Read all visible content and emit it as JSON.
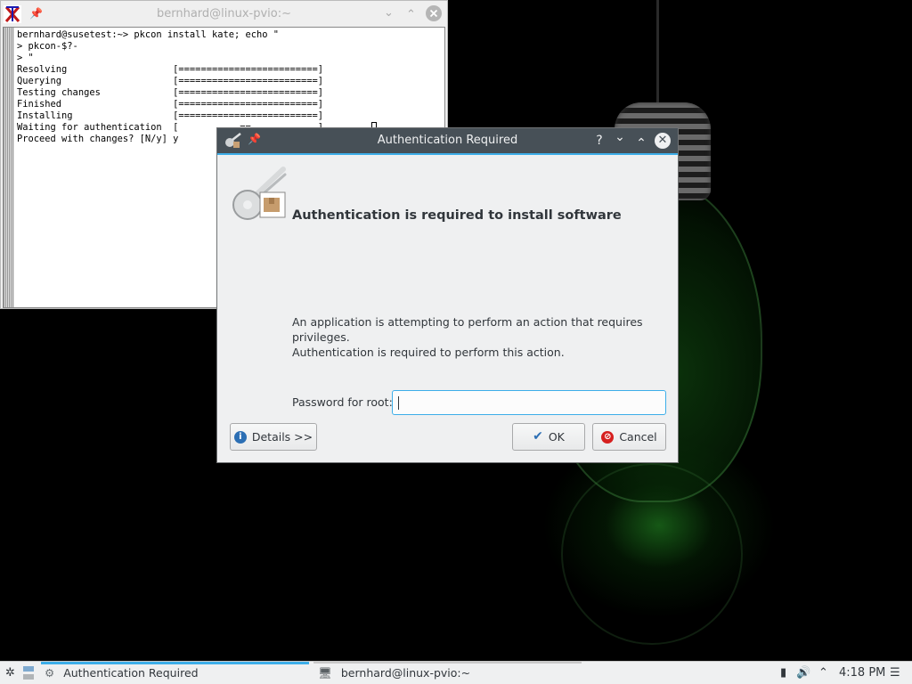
{
  "terminal": {
    "title": "bernhard@linux-pvio:~",
    "lines": [
      "bernhard@susetest:~> pkcon install kate; echo \"",
      "> pkcon-$?-",
      "> \"",
      "Resolving                   [=========================]",
      "Querying                    [=========================]",
      "Testing changes             [=========================]",
      "Finished                    [=========================]",
      "Installing                  [=========================]",
      "Waiting for authentication  [           ==            ]",
      "Proceed with changes? [N/y] y"
    ],
    "icons": {
      "app": "xterm-icon",
      "pin": "pin-icon",
      "min": "chevron-down-icon",
      "max": "chevron-up-icon",
      "close": "close-icon"
    }
  },
  "dialog": {
    "title": "Authentication Required",
    "heading": "Authentication is required to install software",
    "description_line1": "An application is attempting to perform an action that requires privileges.",
    "description_line2": "Authentication is required to perform this action.",
    "password_label": "Password for root:",
    "password_value": "",
    "details_label": "Details >>",
    "ok_label": "OK",
    "cancel_label": "Cancel",
    "title_buttons": {
      "help": "?",
      "minimize": "⌄",
      "maximize": "⌃",
      "close": "✕"
    }
  },
  "taskbar": {
    "tasks": [
      {
        "label": "Authentication Required",
        "icon": "gear-icon"
      },
      {
        "label": "bernhard@linux-pvio:~",
        "icon": "terminal-icon"
      }
    ],
    "clock": "4:18 PM"
  },
  "colors": {
    "accent": "#3daee9",
    "titlebar": "#475057",
    "window_bg": "#eff0f1",
    "desktop_glow": "#1fa01f"
  }
}
